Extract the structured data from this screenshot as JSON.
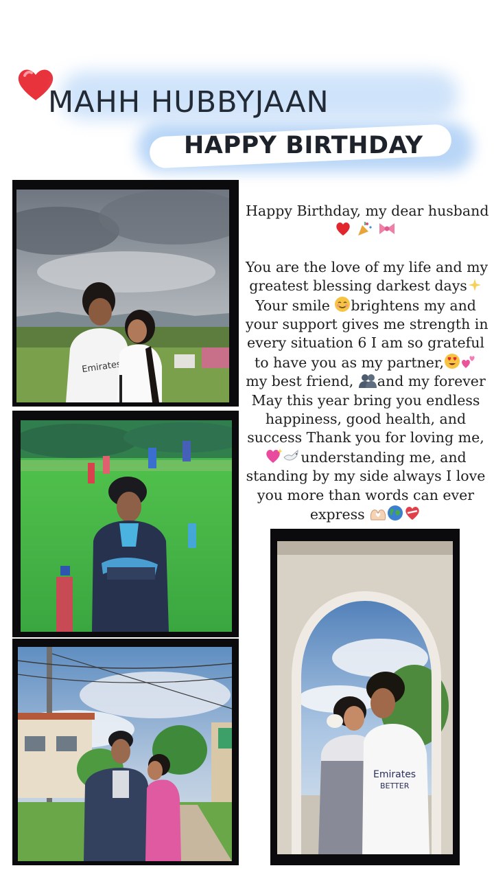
{
  "header": {
    "title": "MAHH HUBBYJAAN",
    "subtitle": "HAPPY BIRTHDAY",
    "heart_color": "#e8323c",
    "glow_color": "#b9d6f7"
  },
  "message": {
    "greeting_line": "Happy Birthday, my dear husband",
    "greeting_emojis": [
      "heart",
      "party-popper",
      "ribbon"
    ],
    "lines": [
      "You are the love of my life and my",
      "greatest blessing darkest days",
      "Your smile",
      "brightens my and",
      "your support gives me strength in",
      "every situation 6 I am so grateful",
      "to have you as my partner,",
      "my best friend,",
      "and my forever",
      "May this year bring you endless",
      "happiness, good health, and",
      "success Thank you for loving me,",
      "understanding me, and",
      "standing by my side always I love",
      "you more than words can ever",
      "express"
    ],
    "inline_emojis": [
      "sparkles",
      "smiling-face",
      "heart-eyes",
      "two-hearts",
      "people-silhouette",
      "sparkling-heart",
      "dove",
      "heart-hands",
      "globe",
      "mending-heart"
    ]
  },
  "photos": [
    {
      "name": "couple-cloudy-sky-photo",
      "jersey_text": "Emirates"
    },
    {
      "name": "man-football-field-photo"
    },
    {
      "name": "couple-village-road-photo"
    },
    {
      "name": "couple-archway-photo",
      "jersey_text": "Emirates BETTER"
    }
  ]
}
